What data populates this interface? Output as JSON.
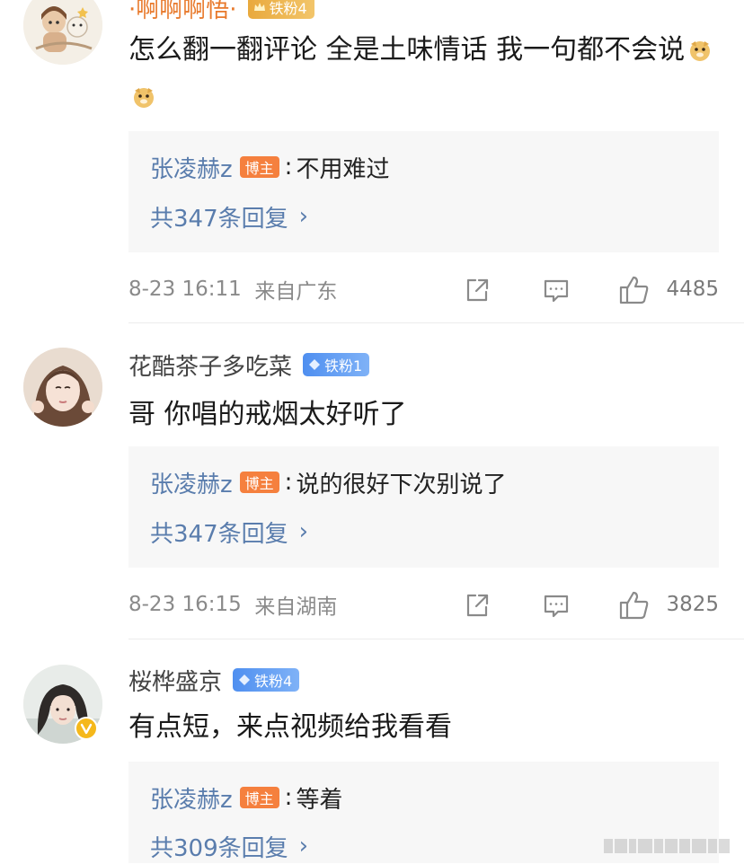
{
  "comments": [
    {
      "username": "·啊啊啊悟·",
      "badge": "铁粉4",
      "text": "怎么翻一翻评论 全是土味情话 我一句都不会说",
      "emojis": [
        "doge-emoji",
        "doge-emoji"
      ],
      "reply": {
        "author": "张凌赫z",
        "tag": "博主",
        "colon": ":",
        "text": "不用难过",
        "count_label": "共347条回复",
        "chevron": "›"
      },
      "time": "8-23 16:11",
      "location": "来自广东",
      "likes": "4485"
    },
    {
      "username": "花酷茶子多吃菜",
      "badge": "铁粉1",
      "text": "哥 你唱的戒烟太好听了",
      "reply": {
        "author": "张凌赫z",
        "tag": "博主",
        "colon": ":",
        "text": "说的很好下次别说了",
        "count_label": "共347条回复",
        "chevron": "›"
      },
      "time": "8-23 16:15",
      "location": "来自湖南",
      "likes": "3825"
    },
    {
      "username": "桜桦盛京",
      "badge": "铁粉4",
      "text": "有点短，来点视频给我看看",
      "reply": {
        "author": "张凌赫z",
        "tag": "博主",
        "colon": ":",
        "text": "等着",
        "count_label": "共309条回复",
        "chevron": "›"
      }
    }
  ],
  "icons": {
    "share": "share-icon",
    "comment": "comment-icon",
    "like": "thumbs-up-icon"
  },
  "colors": {
    "link_blue": "#5a7dad",
    "orange_name": "#e8792b",
    "blogger_tag": "#f5803e",
    "fan_badge_blue": "#4f8ff0",
    "fan_badge_gold": "#e9a93d",
    "reply_bg": "#f7f7f7",
    "meta_gray": "#8a8a8a"
  }
}
